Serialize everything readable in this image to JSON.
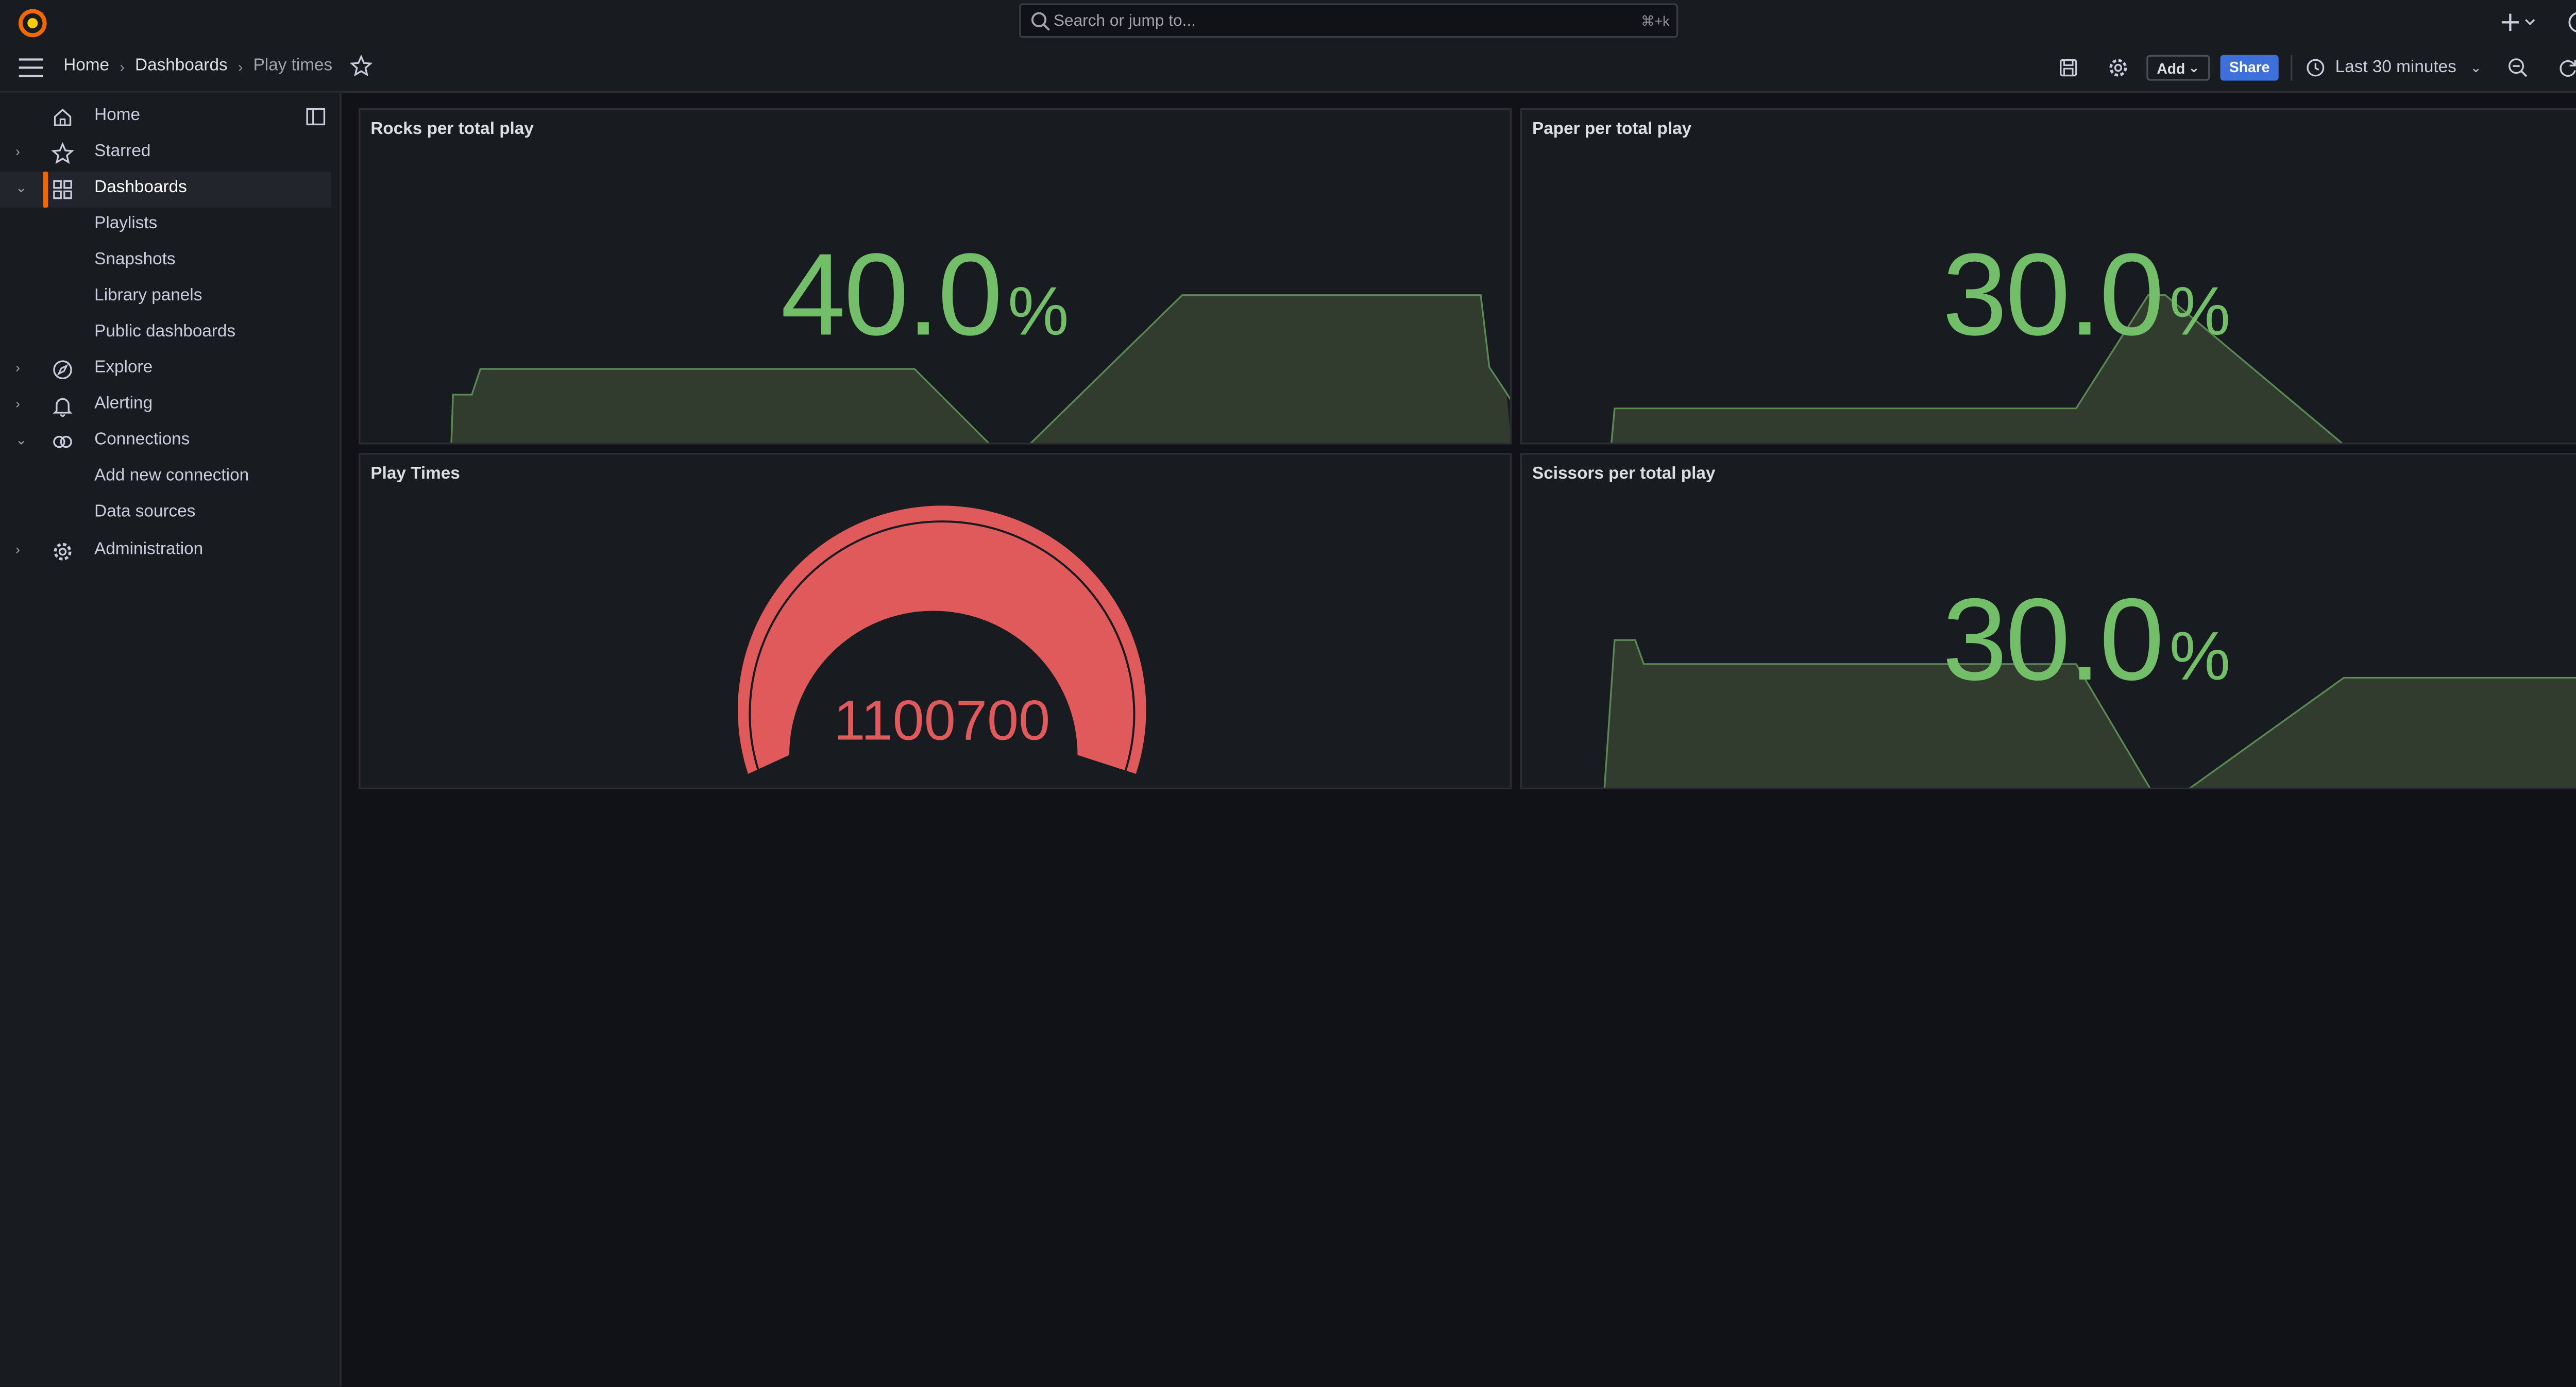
{
  "topbar": {
    "search_placeholder": "Search or jump to...",
    "search_shortcut": "⌘+k",
    "icons": [
      "grafana-logo-icon",
      "search-icon",
      "plus-icon",
      "help-icon",
      "rss-icon",
      "avatar"
    ]
  },
  "navbar": {
    "breadcrumbs": [
      "Home",
      "Dashboards",
      "Play times"
    ],
    "add_label": "Add",
    "share_label": "Share",
    "time_range": "Last 30 minutes"
  },
  "sidebar": {
    "items": [
      {
        "label": "Home",
        "icon": "home-icon"
      },
      {
        "label": "Starred",
        "icon": "star-icon"
      },
      {
        "label": "Dashboards",
        "icon": "apps-icon",
        "active": true
      },
      {
        "label": "Playlists"
      },
      {
        "label": "Snapshots"
      },
      {
        "label": "Library panels"
      },
      {
        "label": "Public dashboards"
      },
      {
        "label": "Explore",
        "icon": "compass-icon"
      },
      {
        "label": "Alerting",
        "icon": "bell-icon"
      },
      {
        "label": "Connections",
        "icon": "connections-icon"
      },
      {
        "label": "Add new connection"
      },
      {
        "label": "Data sources"
      },
      {
        "label": "Administration",
        "icon": "cog-icon"
      }
    ]
  },
  "panels": {
    "rocks": {
      "title": "Rocks per total play",
      "value": "40.0",
      "unit": "%"
    },
    "paper": {
      "title": "Paper per total play",
      "value": "30.0",
      "unit": "%"
    },
    "play_times": {
      "title": "Play Times",
      "value": "1100700"
    },
    "scissors": {
      "title": "Scissors per total play",
      "value": "30.0",
      "unit": "%"
    }
  },
  "colors": {
    "stat_green": "#73bf69",
    "gauge_red": "#e05a5c",
    "accent_orange": "#f46800",
    "share_blue": "#3d71d9"
  }
}
